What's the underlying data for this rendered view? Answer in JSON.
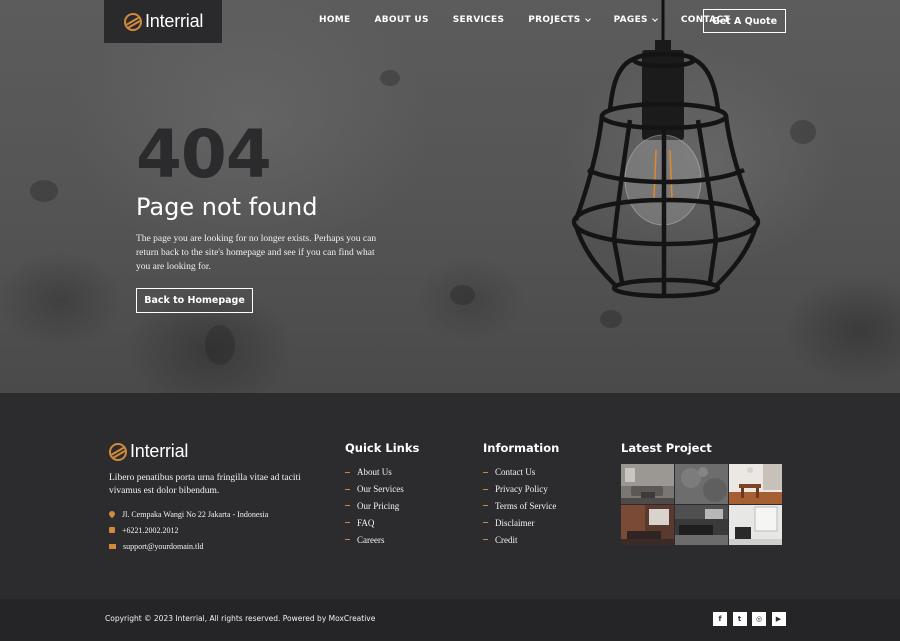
{
  "brand": {
    "name": "Interrial",
    "logo_icon": "interrial-logo-icon",
    "accent": "#d08a3c"
  },
  "nav": {
    "items": [
      {
        "label": "HOME",
        "dropdown": false
      },
      {
        "label": "ABOUT US",
        "dropdown": false
      },
      {
        "label": "SERVICES",
        "dropdown": false
      },
      {
        "label": "PROJECTS",
        "dropdown": true
      },
      {
        "label": "PAGES",
        "dropdown": true
      },
      {
        "label": "CONTACT",
        "dropdown": false
      }
    ],
    "cta_label": "Get A Quote"
  },
  "hero": {
    "code": "404",
    "title": "Page not found",
    "description": "The page you are looking for no longer exists. Perhaps you can return back to the site's homepage and see if you can find what you are looking for.",
    "button_label": "Back to Homepage"
  },
  "footer": {
    "about": "Libero penatibus porta urna fringilla vitae ad taciti vivamus est dolor bibendum.",
    "contacts": [
      {
        "icon": "map-pin-icon",
        "text": "Jl. Cempaka Wangi No 22 Jakarta - Indonesia"
      },
      {
        "icon": "phone-icon",
        "text": "+6221.2002.2012"
      },
      {
        "icon": "mail-icon",
        "text": "support@yourdomain.tld"
      }
    ],
    "quick_links": {
      "title": "Quick Links",
      "items": [
        "About Us",
        "Our Services",
        "Our Pricing",
        "FAQ",
        "Careers"
      ]
    },
    "information": {
      "title": "Information",
      "items": [
        "Contact Us",
        "Privacy Policy",
        "Terms of Service",
        "Disclaimer",
        "Credit"
      ]
    },
    "latest_project": {
      "title": "Latest Project",
      "thumbnails": [
        "living-room-thumbnail",
        "concrete-wall-thumbnail",
        "dining-room-thumbnail",
        "brick-interior-thumbnail",
        "kitchen-thumbnail",
        "white-room-thumbnail"
      ]
    },
    "copyright": "Copyright © 2023 Interrial, All rights reserved. Powered by MoxCreative",
    "social": [
      {
        "icon": "facebook-icon",
        "glyph": "f"
      },
      {
        "icon": "twitter-icon",
        "glyph": "t"
      },
      {
        "icon": "instagram-icon",
        "glyph": "◎"
      },
      {
        "icon": "youtube-icon",
        "glyph": "▶"
      }
    ]
  }
}
